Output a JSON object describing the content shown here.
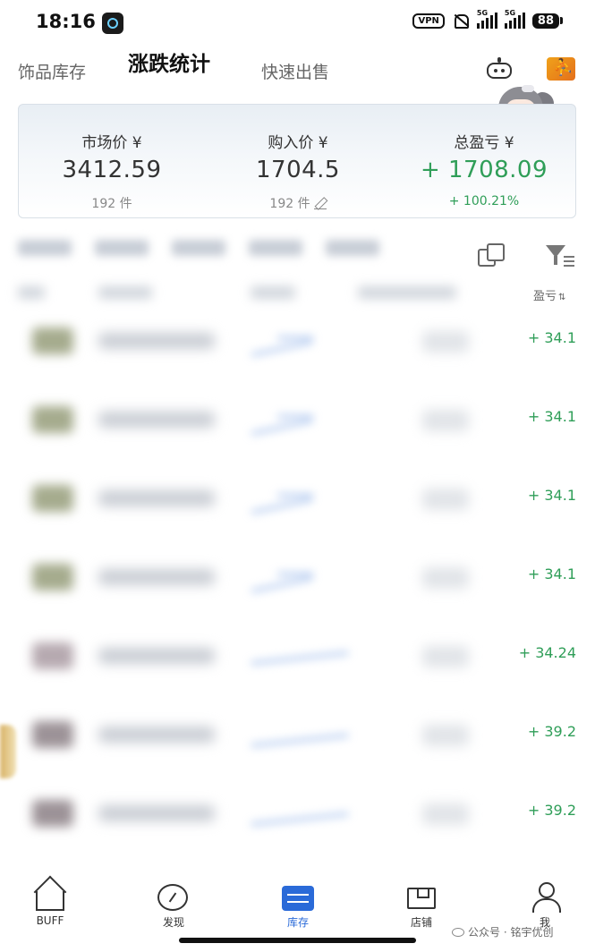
{
  "status_bar": {
    "time": "18:16",
    "vpn": "VPN",
    "sim1": "5G",
    "sim2": "5G",
    "battery": "88"
  },
  "tabs": [
    {
      "label": "饰品库存",
      "active": false
    },
    {
      "label": "涨跌统计",
      "active": true
    },
    {
      "label": "快速出售",
      "active": false
    }
  ],
  "header_icons": [
    "robot-icon",
    "game-icon"
  ],
  "summary": {
    "market_price": {
      "label": "市场价 ¥",
      "value": "3412.59",
      "sub": "192 件"
    },
    "purchase_price": {
      "label": "购入价 ¥",
      "value": "1704.5",
      "sub": "192 件"
    },
    "total_profit": {
      "label": "总盈亏 ¥",
      "value": "+ 1708.09",
      "sub": "+ 100.21%"
    }
  },
  "toolbar": {
    "transfer_icon": "transfer-icon",
    "filter_icon": "filter-icon"
  },
  "columns": {
    "profit_sort_label": "盈亏",
    "sort_arrows": "⇅"
  },
  "rows": [
    {
      "profit": "+ 34.1",
      "thumb_color": "#a5ab8d"
    },
    {
      "profit": "+ 34.1",
      "thumb_color": "#a5ab8d"
    },
    {
      "profit": "+ 34.1",
      "thumb_color": "#a5ab8d"
    },
    {
      "profit": "+ 34.1",
      "thumb_color": "#a5ab8d"
    },
    {
      "profit": "+ 34.24",
      "thumb_color": "#b6a9b0"
    },
    {
      "profit": "+ 39.2",
      "thumb_color": "#9c9297"
    },
    {
      "profit": "+ 39.2",
      "thumb_color": "#9c9297"
    }
  ],
  "bottom_nav": [
    {
      "label": "BUFF",
      "icon": "home-icon",
      "active": false
    },
    {
      "label": "发现",
      "icon": "compass-icon",
      "active": false
    },
    {
      "label": "库存",
      "icon": "inventory-icon",
      "active": true
    },
    {
      "label": "店铺",
      "icon": "shop-icon",
      "active": false
    },
    {
      "label": "我",
      "icon": "person-icon",
      "active": false
    }
  ],
  "watermark": "公众号 · 铭宇优创",
  "colors": {
    "profit_green": "#2f9e58",
    "accent_blue": "#2a6ad8"
  }
}
